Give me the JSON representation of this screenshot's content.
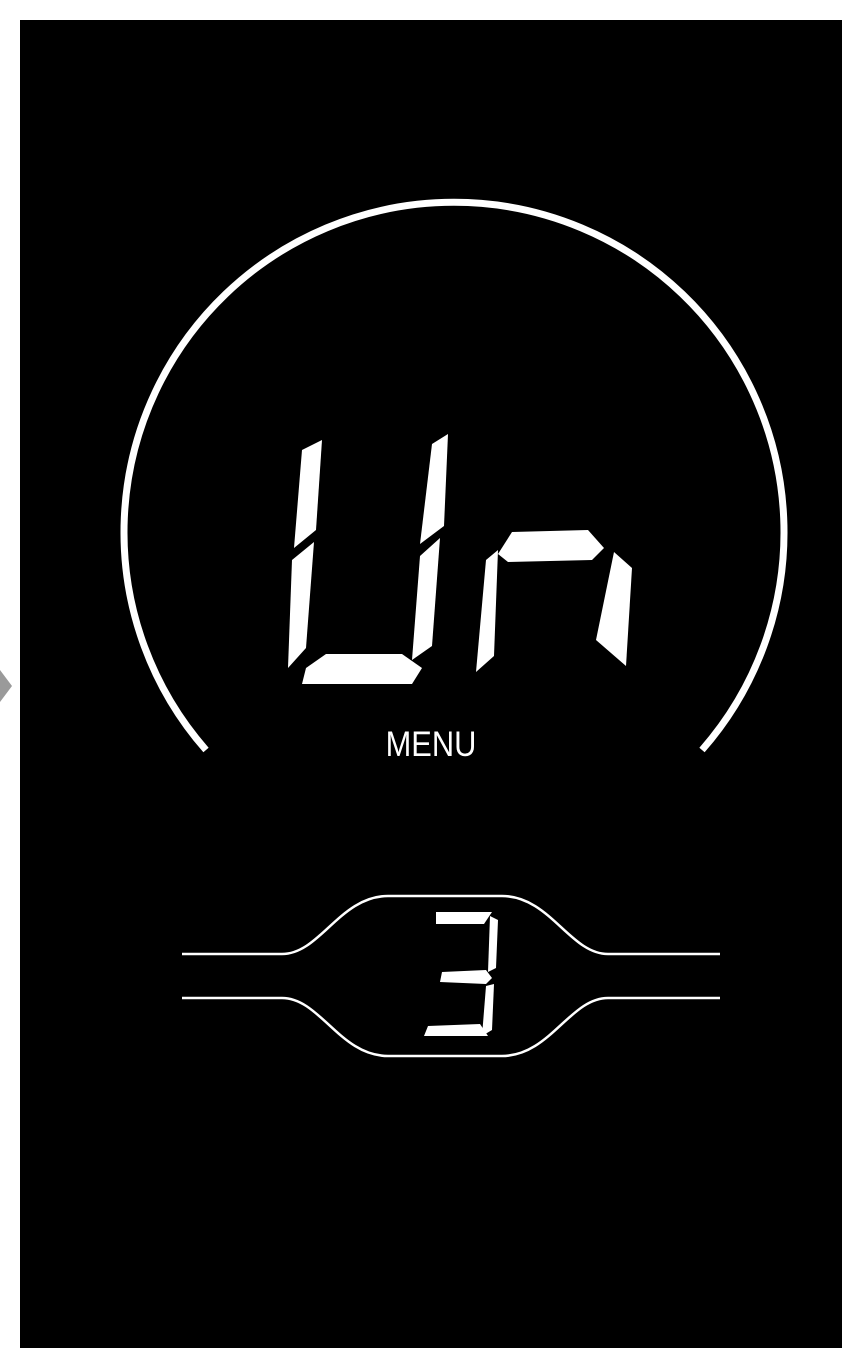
{
  "display": {
    "main_readout": "Un",
    "mode_label": "MENU",
    "assist_level": "3"
  },
  "colors": {
    "screen_background": "#000000",
    "foreground": "#ffffff",
    "page_background": "#ffffff"
  },
  "icons": {
    "side_arrow": "chevron-right-icon"
  }
}
